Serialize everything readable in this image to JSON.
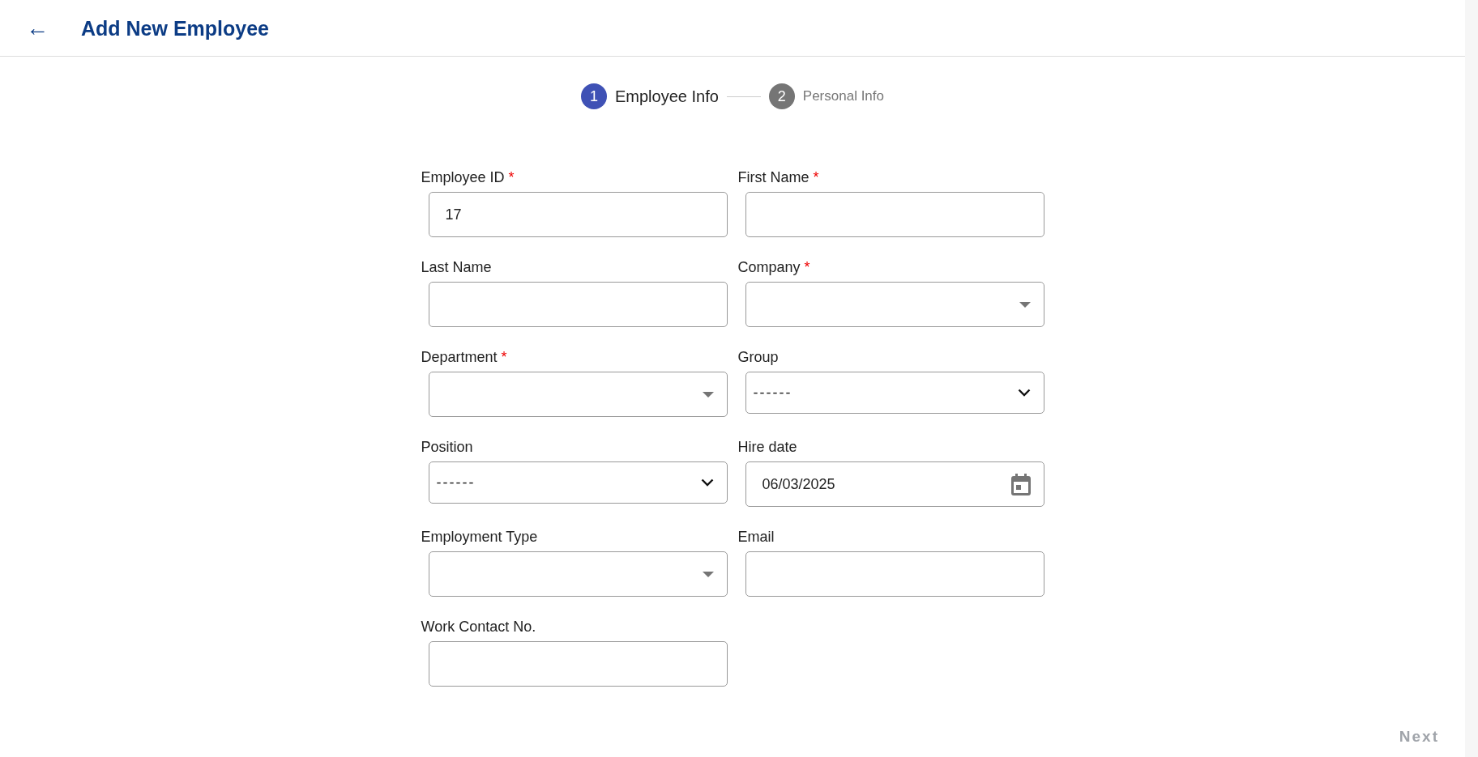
{
  "header": {
    "back": "←",
    "title": "Add New Employee"
  },
  "steps": [
    {
      "number": "1",
      "label": "Employee Info",
      "selected": true
    },
    {
      "number": "2",
      "label": "Personal Info",
      "selected": false
    }
  ],
  "fields": [
    {
      "label": "Employee ID",
      "required": true,
      "kind": "text",
      "value": "17"
    },
    {
      "label": "First Name",
      "required": true,
      "kind": "text"
    },
    {
      "label": "Last Name",
      "required": false,
      "kind": "text"
    },
    {
      "label": "Company",
      "required": true,
      "kind": "dropdown"
    },
    {
      "label": "Department",
      "required": true,
      "kind": "dropdown"
    },
    {
      "label": "Group",
      "required": false,
      "kind": "select",
      "value": "------"
    },
    {
      "label": "Position",
      "required": false,
      "kind": "select",
      "value": "------"
    },
    {
      "label": "Hire date",
      "required": false,
      "kind": "date",
      "value": "06/03/2025"
    },
    {
      "label": "Employment Type",
      "required": false,
      "kind": "dropdown"
    },
    {
      "label": "Email",
      "required": false,
      "kind": "text"
    },
    {
      "label": "Work Contact No.",
      "required": false,
      "kind": "text"
    }
  ],
  "required_mark": "*",
  "next_button": {
    "label": "Next",
    "disabled": true
  }
}
